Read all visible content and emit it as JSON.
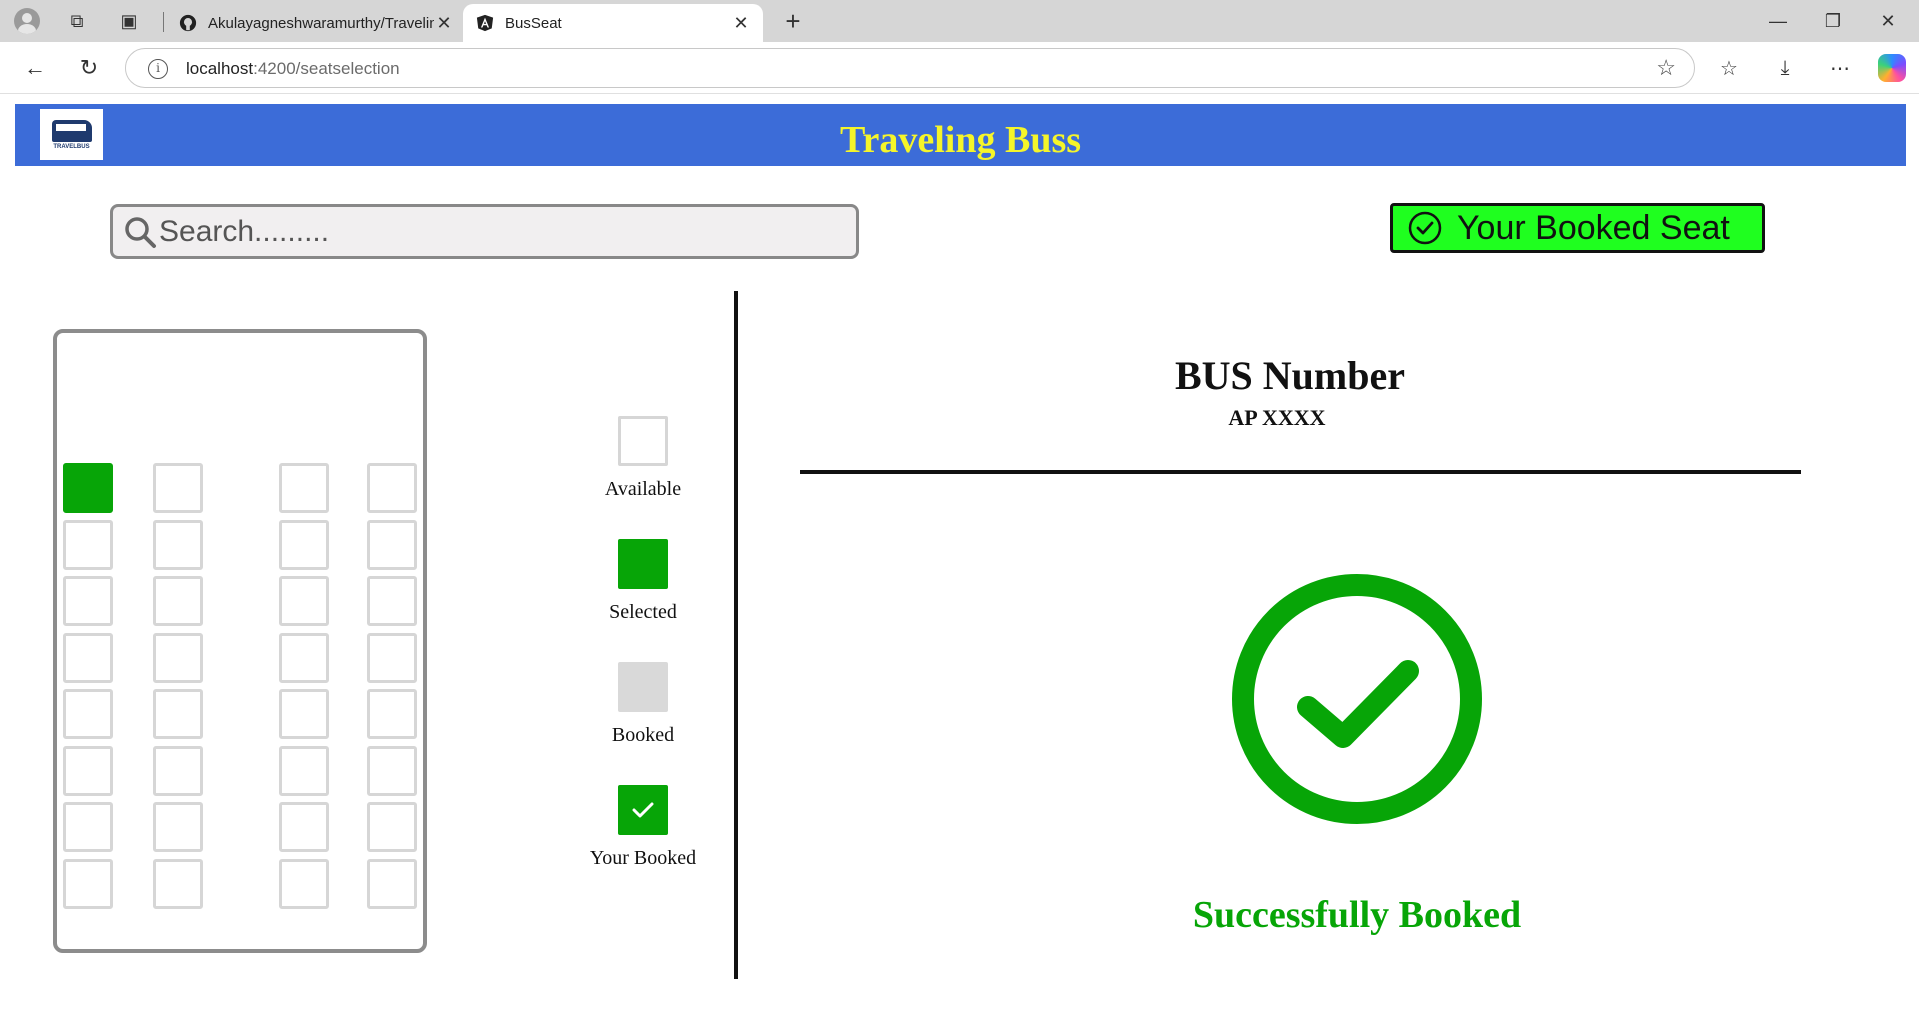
{
  "browser": {
    "tabs": [
      {
        "title": "Akulayagneshwaramurthy/Traveling",
        "active": false
      },
      {
        "title": "BusSeat",
        "active": true
      }
    ],
    "address": {
      "host": "localhost",
      "path": ":4200/seatselection"
    }
  },
  "app": {
    "logo_text": "TRAVELBUS",
    "title": "Traveling Buss",
    "search": {
      "placeholder": "Search........."
    },
    "booked_button_label": "Your Booked Seat",
    "seat_map": {
      "rows": 8,
      "columns": 4,
      "selected_seats": [
        [
          0,
          0
        ]
      ]
    },
    "legend": [
      {
        "key": "available",
        "label": "Available"
      },
      {
        "key": "selected",
        "label": "Selected"
      },
      {
        "key": "booked",
        "label": "Booked"
      },
      {
        "key": "yours",
        "label": "Your Booked"
      }
    ],
    "bus": {
      "heading": "BUS Number",
      "code": "AP XXXX"
    },
    "status_text": "Successfully Booked",
    "colors": {
      "header": "#3c6cd8",
      "title": "#f5f52a",
      "success": "#07a507",
      "booked_button": "#1fff1f"
    }
  }
}
